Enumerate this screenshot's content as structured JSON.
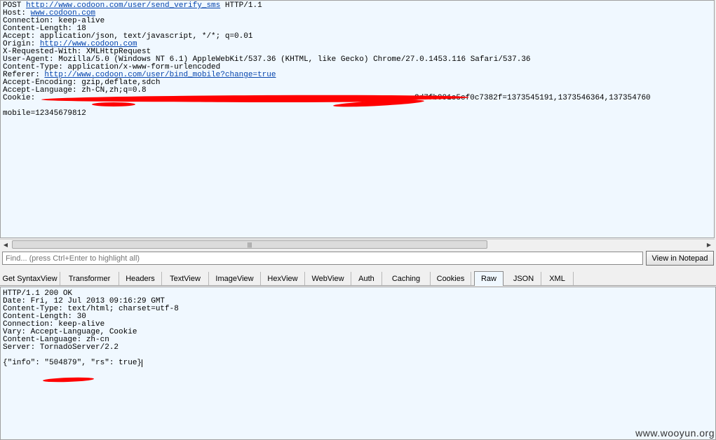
{
  "request": {
    "line_post_method": "POST ",
    "line_post_url": "http://www.codoon.com/user/send_verify_sms",
    "line_post_proto": " HTTP/1.1",
    "host_key": "Host: ",
    "host_val": "www.codoon.com",
    "connection": "Connection: keep-alive",
    "content_length": "Content-Length: 18",
    "accept": "Accept: application/json, text/javascript, */*; q=0.01",
    "origin_key": "Origin: ",
    "origin_val": "http://www.codoon.com",
    "x_requested": "X-Requested-With: XMLHttpRequest",
    "user_agent": "User-Agent: Mozilla/5.0 (Windows NT 6.1) AppleWebKit/537.36 (KHTML, like Gecko) Chrome/27.0.1453.116 Safari/537.36",
    "content_type": "Content-Type: application/x-www-form-urlencoded",
    "referer_key": "Referer: ",
    "referer_val": "http://www.codoon.com/user/bind_mobile?change=true",
    "accept_encoding": "Accept-Encoding: gzip,deflate,sdch",
    "accept_language": "Accept-Language: zh-CN,zh;q=0.8",
    "cookie_key": "Cookie: ",
    "cookie_tail": "2d7fb991e5cf0c7382f=1373545191,1373546364,137354760",
    "body": "mobile=12345679812"
  },
  "find": {
    "placeholder": "Find... (press Ctrl+Enter to highlight all)",
    "notepad_label": "View in Notepad"
  },
  "tabs": [
    {
      "label": "Get SyntaxView"
    },
    {
      "label": "Transformer"
    },
    {
      "label": "Headers"
    },
    {
      "label": "TextView"
    },
    {
      "label": "ImageView"
    },
    {
      "label": "HexView"
    },
    {
      "label": "WebView"
    },
    {
      "label": "Auth"
    },
    {
      "label": "Caching"
    },
    {
      "label": "Cookies"
    },
    {
      "label": "Raw"
    },
    {
      "label": "JSON"
    },
    {
      "label": "XML"
    }
  ],
  "active_tab": "Raw",
  "response": {
    "status": "HTTP/1.1 200 OK",
    "date": "Date: Fri, 12 Jul 2013 09:16:29 GMT",
    "content_type": "Content-Type: text/html; charset=utf-8",
    "content_length": "Content-Length: 30",
    "connection": "Connection: keep-alive",
    "vary": "Vary: Accept-Language, Cookie",
    "content_language": "Content-Language: zh-cn",
    "server": "Server: TornadoServer/2.2",
    "body": "{\"info\": \"504879\", \"rs\": true}"
  },
  "watermark": "www.wooyun.org",
  "colors": {
    "pane_bg": "#f0f8ff",
    "link": "#0645ad",
    "redaction": "#ff0000"
  }
}
